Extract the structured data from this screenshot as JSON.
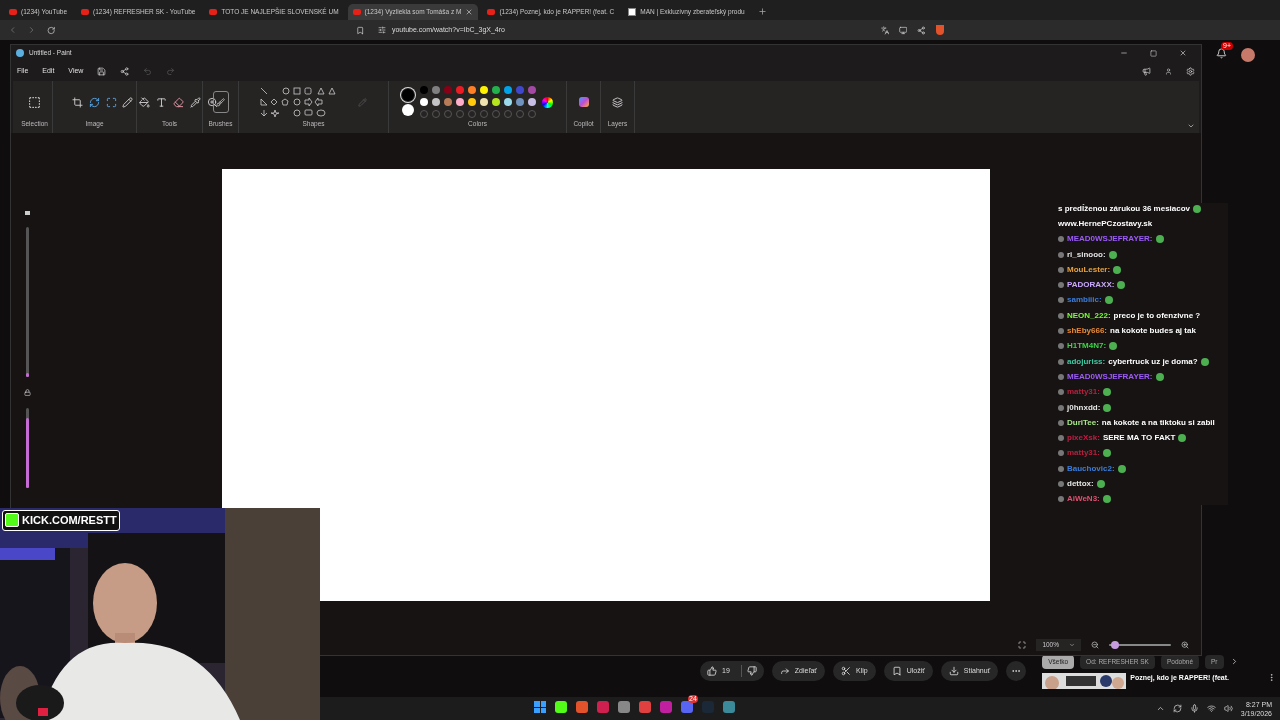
{
  "browser": {
    "tabs": [
      {
        "label": "(1234) YouTube",
        "kind": "youtube",
        "selected": false
      },
      {
        "label": "(1234) REFRESHER SK - YouTube",
        "kind": "youtube",
        "selected": false
      },
      {
        "label": "TOTO JE NAJLEPŠIE SLOVENSKÉ UM",
        "kind": "youtube",
        "selected": false
      },
      {
        "label": "(1234) Vyzliekla som Tomáša z M",
        "kind": "youtube",
        "selected": true
      },
      {
        "label": "(1234) Poznej, kdo je RAPPER! (feat. C",
        "kind": "youtube",
        "selected": false
      },
      {
        "label": "MAN | Exkluzívny zberateľský produ",
        "kind": "site",
        "selected": false
      }
    ],
    "address": "youtube.com/watch?v=IbC_3gX_4ro",
    "notifications_badge": "9+"
  },
  "paint": {
    "title": "Untitled - Paint",
    "menu": [
      "File",
      "Edit",
      "View"
    ],
    "groups": [
      "Selection",
      "Image",
      "Tools",
      "Brushes",
      "Shapes",
      "Colors",
      "Copilot",
      "Layers"
    ],
    "current_colors": [
      {
        "color": "#000000",
        "selected": true
      },
      {
        "color": "#ffffff",
        "selected": false
      }
    ],
    "swatches": [
      {
        "color": "#000000"
      },
      {
        "color": "#7f7f7f"
      },
      {
        "color": "#880015"
      },
      {
        "color": "#ed1c24"
      },
      {
        "color": "#ff7f27"
      },
      {
        "color": "#fff200"
      },
      {
        "color": "#22b14c"
      },
      {
        "color": "#00a2e8"
      },
      {
        "color": "#3f48cc"
      },
      {
        "color": "#a349a4"
      },
      {
        "color": "#ffffff"
      },
      {
        "color": "#c3c3c3"
      },
      {
        "color": "#b97a57"
      },
      {
        "color": "#ffaec9"
      },
      {
        "color": "#ffc90e"
      },
      {
        "color": "#efe4b0"
      },
      {
        "color": "#b5e61d"
      },
      {
        "color": "#99d9ea"
      },
      {
        "color": "#7092be"
      },
      {
        "color": "#c8bfe7"
      }
    ],
    "side_sliders": [
      {
        "level": 0.03
      },
      {
        "level": 0.87
      }
    ],
    "zoom": {
      "value": "100%",
      "level": 0.1
    }
  },
  "chat": {
    "messages": [
      {
        "kind": "text",
        "text": "s predĺženou zárukou 36 mesiacov",
        "emote": true
      },
      {
        "kind": "text",
        "text": "www.HernePCzostavy.sk",
        "emote": false
      },
      {
        "kind": "message",
        "user": "MEAD0WSJEFRAYER:",
        "color": "#9b5cf6",
        "emote": true
      },
      {
        "kind": "message",
        "user": "ri_sinooo:",
        "color": "#e5e5e5",
        "emote": true
      },
      {
        "kind": "message",
        "user": "MouLester:",
        "color": "#e8a23a",
        "emote": true
      },
      {
        "kind": "message",
        "user": "PADORAXX:",
        "color": "#c9a8ff",
        "emote": true
      },
      {
        "kind": "message",
        "user": "sambiiic:",
        "color": "#3b7dd8",
        "emote": true
      },
      {
        "kind": "message",
        "user": "NEON_222:",
        "color": "#7cfc3c",
        "text": "preco je to ofenzivne ?",
        "emote": false
      },
      {
        "kind": "message",
        "user": "shEby666:",
        "color": "#e88a34",
        "text": "na kokote budes aj tak",
        "emote": false
      },
      {
        "kind": "message",
        "user": "H1TM4N7:",
        "color": "#3fd24a",
        "emote": true
      },
      {
        "kind": "message",
        "user": "adojuriss:",
        "color": "#3ecaa2",
        "text": "cybertruck uz je doma?",
        "emote": true
      },
      {
        "kind": "message",
        "user": "MEAD0WSJEFRAYER:",
        "color": "#9b5cf6",
        "emote": true
      },
      {
        "kind": "message",
        "user": "matty31:",
        "color": "#b3203d",
        "emote": true
      },
      {
        "kind": "message",
        "user": "j0hnxdd:",
        "color": "#e5e5e5",
        "emote": true
      },
      {
        "kind": "message",
        "user": "DuriTee:",
        "color": "#a8e68a",
        "text": "na kokote a na tiktoku si zabil",
        "emote": false
      },
      {
        "kind": "message",
        "user": "pixeXsk:",
        "color": "#c21d45",
        "text": "SERE MA TO FAKT",
        "emote": true
      },
      {
        "kind": "message",
        "user": "matty31:",
        "color": "#b3203d",
        "emote": true
      },
      {
        "kind": "message",
        "user": "Bauchovic2:",
        "color": "#3b7dd8",
        "emote": true
      },
      {
        "kind": "message",
        "user": "dettox:",
        "color": "#e5e5e5",
        "emote": true
      },
      {
        "kind": "message",
        "user": "AiWeN3:",
        "color": "#e0506f",
        "emote": true
      }
    ]
  },
  "webcam": {
    "kind": "picture",
    "overlay": "KICK.COM/RESTT"
  },
  "youtube": {
    "likes": "19",
    "actions": [
      {
        "kind": "share",
        "label": "Zdieľať"
      },
      {
        "kind": "clip",
        "label": "Klip"
      },
      {
        "kind": "save",
        "label": "Uložiť"
      },
      {
        "kind": "download",
        "label": "Stiahnuť"
      }
    ],
    "chips": [
      {
        "label": "Všetko",
        "selected": true
      },
      {
        "label": "Od: REFRESHER SK",
        "selected": false
      },
      {
        "label": "Podobné",
        "selected": false
      },
      {
        "label": "Pr",
        "selected": false
      }
    ],
    "recommended": {
      "title": "Poznej, kdo je RAPPER! (feat."
    }
  },
  "taskbar": {
    "badge": "24",
    "time": "8:27 PM",
    "date": "3/19/2026"
  }
}
